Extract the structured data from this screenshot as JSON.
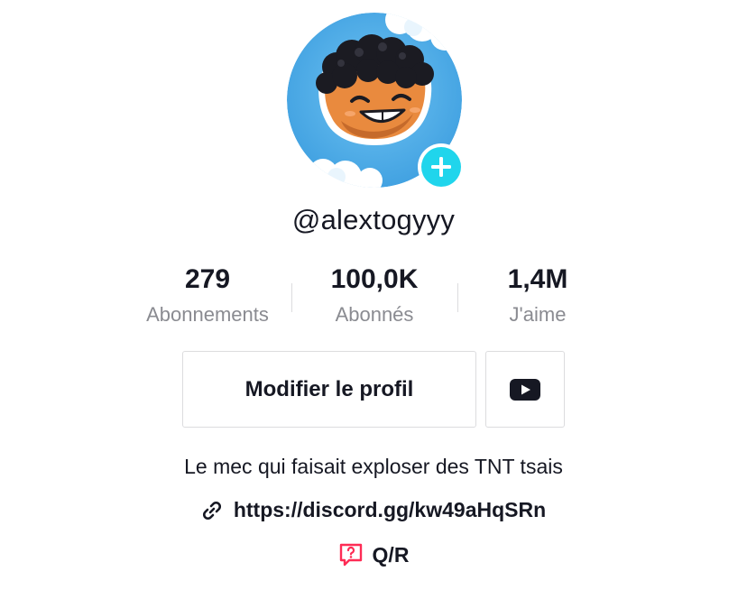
{
  "profile": {
    "username": "@alextogyyy",
    "avatar_icon": "cartoon-avatar",
    "add_icon": "plus-icon"
  },
  "stats": [
    {
      "value": "279",
      "label": "Abonnements"
    },
    {
      "value": "100,0K",
      "label": "Abonnés"
    },
    {
      "value": "1,4M",
      "label": "J'aime"
    }
  ],
  "actions": {
    "edit_profile_label": "Modifier le profil",
    "youtube_icon": "youtube-icon"
  },
  "bio": {
    "text": "Le mec qui faisait exploser des TNT tsais",
    "link": "https://discord.gg/kw49aHqSRn",
    "qa_label": "Q/R"
  },
  "colors": {
    "accent": "#20d5ec",
    "qa_icon": "#fe2c55",
    "text": "#161823",
    "muted": "#8a8b91"
  }
}
